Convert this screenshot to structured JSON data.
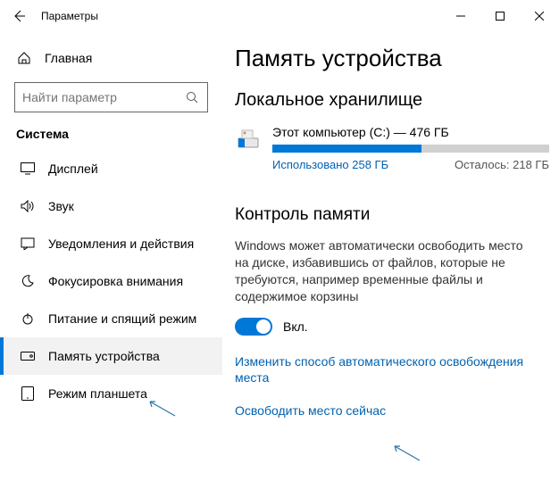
{
  "titlebar": {
    "title": "Параметры"
  },
  "sidebar": {
    "home_label": "Главная",
    "search_placeholder": "Найти параметр",
    "group_label": "Система",
    "items": [
      {
        "label": "Дисплей"
      },
      {
        "label": "Звук"
      },
      {
        "label": "Уведомления и действия"
      },
      {
        "label": "Фокусировка внимания"
      },
      {
        "label": "Питание и спящий режим"
      },
      {
        "label": "Память устройства"
      },
      {
        "label": "Режим планшета"
      }
    ]
  },
  "main": {
    "page_title": "Память устройства",
    "local_storage_heading": "Локальное хранилище",
    "drive": {
      "name": "Этот компьютер (C:) — 476 ГБ",
      "used_label": "Использовано 258 ГБ",
      "remain_label": "Осталось: 218 ГБ"
    },
    "storage_sense": {
      "heading": "Контроль памяти",
      "description": "Windows может автоматически освободить место на диске, избавившись от файлов, которые не требуются, например временные файлы и содержимое корзины",
      "toggle_label": "Вкл.",
      "link_configure": "Изменить способ автоматического освобождения места",
      "link_freenow": "Освободить место сейчас"
    }
  }
}
